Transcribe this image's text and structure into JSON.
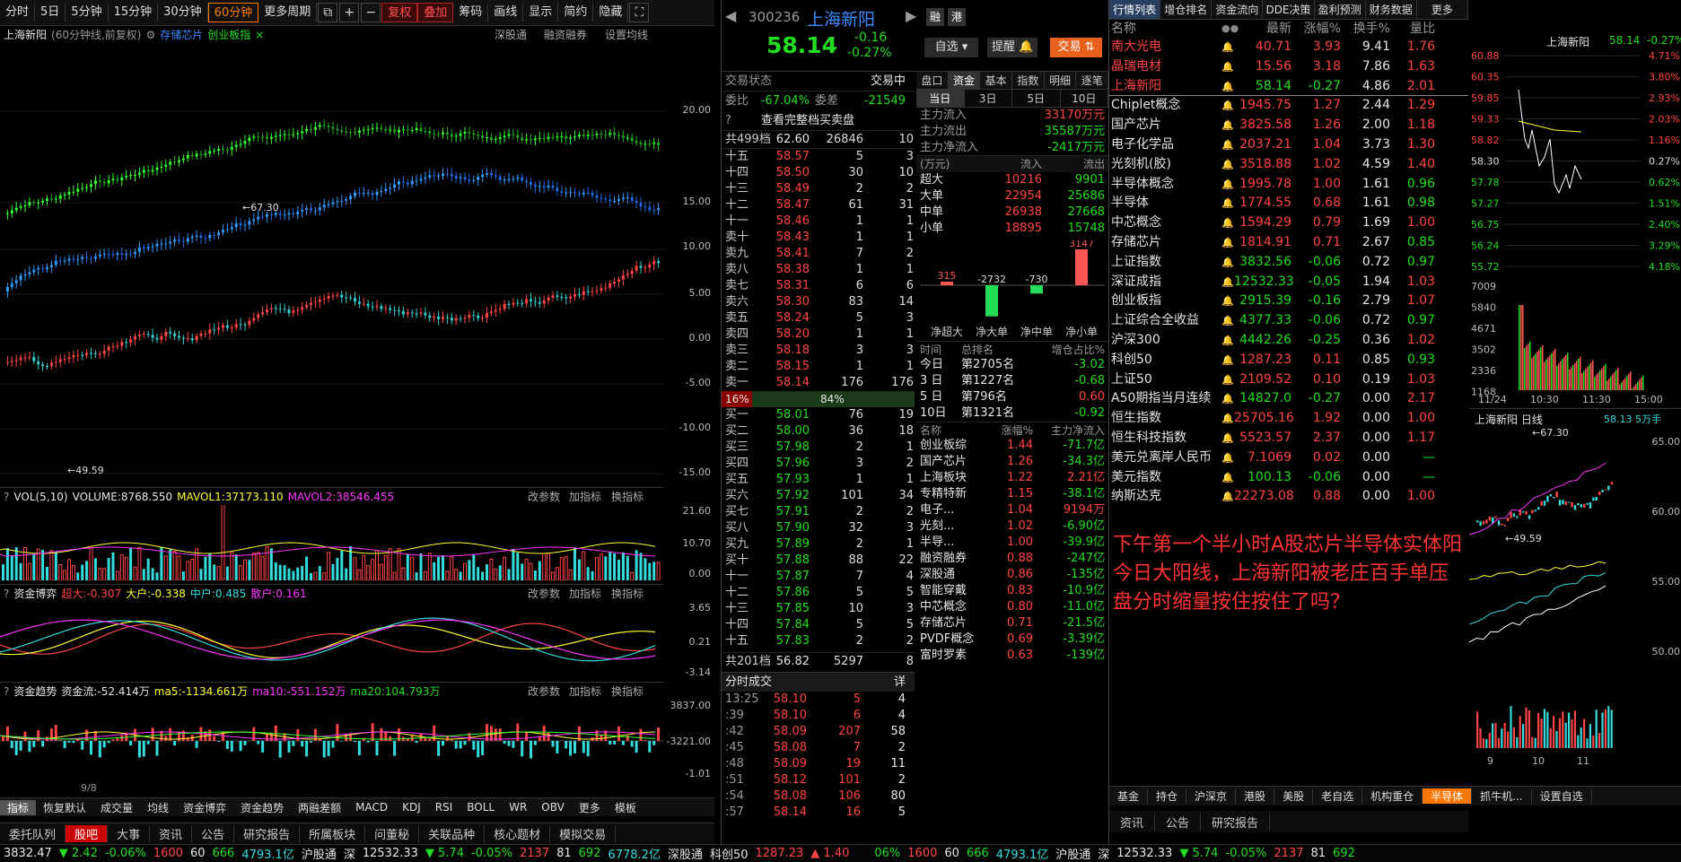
{
  "toolbar": [
    "分时",
    "5日",
    "5分钟",
    "15分钟",
    "30分钟",
    "60分钟",
    "更多周期",
    "复权",
    "叠加",
    "筹码",
    "画线",
    "显示",
    "简约",
    "隐藏"
  ],
  "chart": {
    "stock": "上海新阳",
    "desc": "(60分钟线,前复权)",
    "tag1": "存储芯片",
    "tag2": "创业板指",
    "btn1": "深股通",
    "btn2": "融资融券",
    "btn3": "设置均线",
    "hi": "67.30",
    "lo": "49.59",
    "axis": [
      "20.00",
      "15.00",
      "10.00",
      "5.00",
      "0.00",
      "-5.00",
      "-10.00",
      "-15.00"
    ]
  },
  "vol": {
    "label": "VOL(5,10)",
    "v": "VOLUME:8768.550",
    "m1": "MAVOL1:37173.110",
    "m2": "MAVOL2:38546.455",
    "axis": [
      "21.60",
      "10.70",
      "0.00"
    ],
    "b1": "改参数",
    "b2": "加指标",
    "b3": "换指标"
  },
  "zjbp": {
    "label": "资金博弈",
    "a": "超大:-0.307",
    "b": "大户:-0.338",
    "c": "中户:0.485",
    "d": "散户:0.161",
    "axis": [
      "3.65",
      "0.21",
      "-3.14"
    ]
  },
  "zjqs": {
    "label": "资金趋势",
    "a": "资金流:-52.414万",
    "b": "ma5:-1134.661万",
    "c": "ma10:-551.152万",
    "d": "ma20:104.793万",
    "axis": [
      "3837.00",
      "-3221.00",
      "-1.01"
    ],
    "date": "9/8"
  },
  "ind_tabs": [
    "指标",
    "恢复默认",
    "成交量",
    "均线",
    "资金博弈",
    "资金趋势",
    "两融差额",
    "MACD",
    "KDJ",
    "RSI",
    "BOLL",
    "WR",
    "OBV",
    "更多",
    "模板"
  ],
  "nav2": [
    "委托队列",
    "股吧",
    "大事",
    "资讯",
    "公告",
    "研究报告",
    "所属板块",
    "问董秘",
    "关联品种",
    "核心题材",
    "模拟交易"
  ],
  "status": {
    "idx": "3832.47",
    "chg": "2.42",
    "pct": "-0.06%",
    "up": "1600",
    "flat": "60",
    "down": "666",
    "amt": "4793.1亿",
    "hgt": "沪股通",
    "sz": "深",
    "szv": "12532.33",
    "szc": "5.74",
    "szp": "-0.05%",
    "szu": "2137",
    "szf": "81",
    "szd": "692",
    "sza": "6778.2亿",
    "sgt": "深股通",
    "kc": "科创50",
    "kcv": "1287.23",
    "kcc": "1.40"
  },
  "quote": {
    "code": "300236",
    "name": "上海新阳",
    "price": "58.14",
    "chg": "-0.16",
    "pct": "-0.27%",
    "zx": "自选",
    "tx": "提醒",
    "jy": "交易",
    "rz": "融",
    "gang": "港"
  },
  "book": {
    "state": "交易状态",
    "statev": "交易中",
    "wb": "委比",
    "wbv": "-67.04%",
    "wc": "委差",
    "wcv": "-21549",
    "full": "查看完整档买卖盘",
    "sellhdr": "共499档",
    "sellhdr_p": "62.60",
    "sellhdr_v": "26846",
    "sellhdr_c": "10",
    "buyhdr": "共201档",
    "buyhdr_p": "56.82",
    "buyhdr_v": "5297",
    "buyhdr_c": "8",
    "pct1": "16%",
    "pct2": "84%",
    "sells": [
      [
        "十五",
        "58.57",
        "5",
        "3"
      ],
      [
        "十四",
        "58.50",
        "30",
        "10"
      ],
      [
        "十三",
        "58.49",
        "2",
        "2"
      ],
      [
        "十二",
        "58.47",
        "61",
        "31"
      ],
      [
        "十一",
        "58.46",
        "1",
        "1"
      ],
      [
        "卖十",
        "58.43",
        "1",
        "1"
      ],
      [
        "卖九",
        "58.41",
        "7",
        "2"
      ],
      [
        "卖八",
        "58.38",
        "1",
        "1"
      ],
      [
        "卖七",
        "58.31",
        "6",
        "6"
      ],
      [
        "卖六",
        "58.30",
        "83",
        "14"
      ],
      [
        "卖五",
        "58.24",
        "5",
        "3"
      ],
      [
        "卖四",
        "58.20",
        "1",
        "1"
      ],
      [
        "卖三",
        "58.18",
        "3",
        "3"
      ],
      [
        "卖二",
        "58.15",
        "1",
        "1"
      ],
      [
        "卖一",
        "58.14",
        "176",
        "176"
      ]
    ],
    "buys": [
      [
        "买一",
        "58.01",
        "76",
        "19"
      ],
      [
        "买二",
        "58.00",
        "36",
        "18"
      ],
      [
        "买三",
        "57.98",
        "2",
        "1"
      ],
      [
        "买四",
        "57.96",
        "3",
        "2"
      ],
      [
        "买五",
        "57.93",
        "1",
        "1"
      ],
      [
        "买六",
        "57.92",
        "101",
        "34"
      ],
      [
        "买七",
        "57.91",
        "2",
        "2"
      ],
      [
        "买八",
        "57.90",
        "32",
        "3"
      ],
      [
        "买九",
        "57.89",
        "2",
        "1"
      ],
      [
        "买十",
        "57.88",
        "88",
        "22"
      ],
      [
        "十一",
        "57.87",
        "7",
        "4"
      ],
      [
        "十二",
        "57.86",
        "5",
        "5"
      ],
      [
        "十三",
        "57.85",
        "10",
        "3"
      ],
      [
        "十四",
        "57.84",
        "5",
        "5"
      ],
      [
        "十五",
        "57.83",
        "2",
        "2"
      ]
    ]
  },
  "ticks": {
    "title": "分时成交",
    "more": "详",
    "rows": [
      [
        "13:25",
        "58.10",
        "5",
        "4"
      ],
      [
        ":39",
        "58.10",
        "6",
        "4"
      ],
      [
        ":42",
        "58.09",
        "207",
        "58"
      ],
      [
        ":45",
        "58.08",
        "7",
        "2"
      ],
      [
        ":48",
        "58.09",
        "19",
        "11"
      ],
      [
        ":51",
        "58.12",
        "101",
        "2"
      ],
      [
        ":54",
        "58.08",
        "106",
        "80"
      ],
      [
        ":57",
        "58.14",
        "16",
        "5"
      ]
    ]
  },
  "fund": {
    "tabs": [
      "盘口",
      "资金",
      "基本",
      "指数",
      "明细",
      "逐笔"
    ],
    "tabs2": [
      "当日",
      "3日",
      "5日",
      "10日"
    ],
    "in": "主力流入",
    "inv": "33170万元",
    "out": "主力流出",
    "outv": "35587万元",
    "net": "主力净流入",
    "netv": "-2417万元",
    "unit": "(万元)",
    "lr": "流入",
    "lc": "流出",
    "rows": [
      [
        "超大",
        "10216",
        "9901"
      ],
      [
        "大单",
        "22954",
        "25686"
      ],
      [
        "中单",
        "26938",
        "27668"
      ],
      [
        "小单",
        "18895",
        "15748"
      ]
    ],
    "bars": [
      "315",
      "-2732",
      "-730",
      "3147"
    ],
    "barl": [
      "净超大",
      "净大单",
      "净中单",
      "净小单"
    ],
    "rank": {
      "h1": "时间",
      "h2": "总排名",
      "h3": "增仓占比%",
      "rows": [
        [
          "今日",
          "第2705名",
          "-3.02"
        ],
        [
          "3 日",
          "第1227名",
          "-0.68"
        ],
        [
          "5 日",
          "第796名",
          "0.60"
        ],
        [
          "10日",
          "第1321名",
          "-0.92"
        ]
      ]
    },
    "plate": {
      "h1": "名称",
      "h2": "涨幅%",
      "h3": "主力净流入",
      "rows": [
        [
          "创业板综",
          "1.44",
          "-71.7亿"
        ],
        [
          "国产芯片",
          "1.26",
          "-34.3亿"
        ],
        [
          "上海板块",
          "1.22",
          "2.21亿"
        ],
        [
          "专精特新",
          "1.15",
          "-38.1亿"
        ],
        [
          "电子...",
          "1.04",
          "9194万"
        ],
        [
          "光刻...",
          "1.02",
          "-6.90亿"
        ],
        [
          "半导...",
          "1.00",
          "-39.9亿"
        ],
        [
          "融资融券",
          "0.88",
          "-247亿"
        ],
        [
          "深股通",
          "0.86",
          "-135亿"
        ],
        [
          "智能穿戴",
          "0.83",
          "-10.9亿"
        ],
        [
          "中芯概念",
          "0.80",
          "-11.0亿"
        ],
        [
          "存储芯片",
          "0.71",
          "-21.5亿"
        ],
        [
          "PVDF概念",
          "0.69",
          "-3.39亿"
        ],
        [
          "富时罗素",
          "0.63",
          "-139亿"
        ]
      ]
    }
  },
  "rtabs": [
    "行情列表",
    "增仓排名",
    "资金流向",
    "DDE决策",
    "盈利预测",
    "财务数据",
    "更多"
  ],
  "qhead": [
    "名称",
    "最新",
    "涨幅%",
    "换手%",
    "量比"
  ],
  "quotes": [
    [
      "南大光电",
      "40.71",
      "3.93",
      "9.41",
      "1.76"
    ],
    [
      "晶瑞电材",
      "15.56",
      "3.18",
      "7.86",
      "1.63"
    ],
    [
      "上海新阳",
      "58.14",
      "-0.27",
      "4.86",
      "2.01"
    ],
    [
      "Chiplet概念",
      "1945.75",
      "1.27",
      "2.44",
      "1.29"
    ],
    [
      "国产芯片",
      "3825.58",
      "1.26",
      "2.00",
      "1.18"
    ],
    [
      "电子化学品",
      "2037.21",
      "1.04",
      "3.73",
      "1.30"
    ],
    [
      "光刻机(胶)",
      "3518.88",
      "1.02",
      "4.59",
      "1.40"
    ],
    [
      "半导体概念",
      "1995.78",
      "1.00",
      "1.61",
      "0.96"
    ],
    [
      "半导体",
      "1774.55",
      "0.68",
      "1.61",
      "0.98"
    ],
    [
      "中芯概念",
      "1594.29",
      "0.79",
      "1.69",
      "1.00"
    ],
    [
      "存储芯片",
      "1814.91",
      "0.71",
      "2.67",
      "0.85"
    ],
    [
      "上证指数",
      "3832.56",
      "-0.06",
      "0.72",
      "0.97"
    ],
    [
      "深证成指",
      "12532.33",
      "-0.05",
      "1.94",
      "1.03"
    ],
    [
      "创业板指",
      "2915.39",
      "-0.16",
      "2.79",
      "1.07"
    ],
    [
      "上证综合全收益",
      "4377.33",
      "-0.06",
      "0.72",
      "0.97"
    ],
    [
      "沪深300",
      "4442.26",
      "-0.25",
      "0.36",
      "1.02"
    ],
    [
      "科创50",
      "1287.23",
      "0.11",
      "0.85",
      "0.93"
    ],
    [
      "上证50",
      "2109.52",
      "0.10",
      "0.19",
      "1.03"
    ],
    [
      "A50期指当月连续",
      "14827.0",
      "-0.27",
      "0.00",
      "2.17"
    ],
    [
      "恒生指数",
      "25705.16",
      "1.92",
      "0.00",
      "1.00"
    ],
    [
      "恒生科技指数",
      "5523.57",
      "2.37",
      "0.00",
      "1.17"
    ],
    [
      "美元兑离岸人民币",
      "7.1069",
      "0.02",
      "0.00",
      "—"
    ],
    [
      "美元指数",
      "100.13",
      "-0.06",
      "0.00",
      "—"
    ],
    [
      "纳斯达克",
      "22273.08",
      "0.88",
      "0.00",
      "1.00"
    ]
  ],
  "news": "下午第一个半小时A股芯片半导体实体阳今日大阳线，上海新阳被老庄百手单压盘分时缩量按住按住了吗？",
  "mini": {
    "name": "上海新阳",
    "price": "58.14",
    "pct": "-0.27%",
    "yl": [
      "60.88",
      "60.35",
      "59.85",
      "59.33",
      "58.82",
      "58.30",
      "57.78",
      "57.27",
      "56.75",
      "56.24",
      "55.72"
    ],
    "pl": [
      "4.71%",
      "3.80%",
      "2.93%",
      "2.03%",
      "1.16%",
      "0.27%",
      "0.62%",
      "1.51%",
      "2.40%",
      "3.29%",
      "4.18%"
    ],
    "vl": [
      "7009",
      "5840",
      "4671",
      "3502",
      "2336",
      "1168"
    ],
    "t": [
      "11/24",
      "10:30",
      "11:30",
      "15:00"
    ]
  },
  "day": {
    "name": "上海新阳 日线",
    "price": "58.13",
    "unit": "5万手",
    "hi": "67.30",
    "lo": "49.59",
    "yl": [
      "65.00",
      "60.00",
      "55.00",
      "50.00"
    ],
    "xl": [
      "9",
      "10",
      "11"
    ]
  },
  "btab": [
    "基金",
    "持仓",
    "沪深京",
    "港股",
    "美股",
    "老自选",
    "机构重仓",
    "半导体",
    "抓牛机..."
  ],
  "btab_set": "设置自选",
  "btab2": [
    "资讯",
    "公告",
    "研究报告"
  ],
  "status_r": {
    "p": "06%",
    "u": "1600",
    "f": "60",
    "d": "666",
    "a": "4793.1亿",
    "hgt": "沪股通",
    "sz": "深",
    "v": "12532.33",
    "c": "5.74",
    "pp": "-0.05%",
    "uu": "2137",
    "ff": "81",
    "dd": "692"
  }
}
